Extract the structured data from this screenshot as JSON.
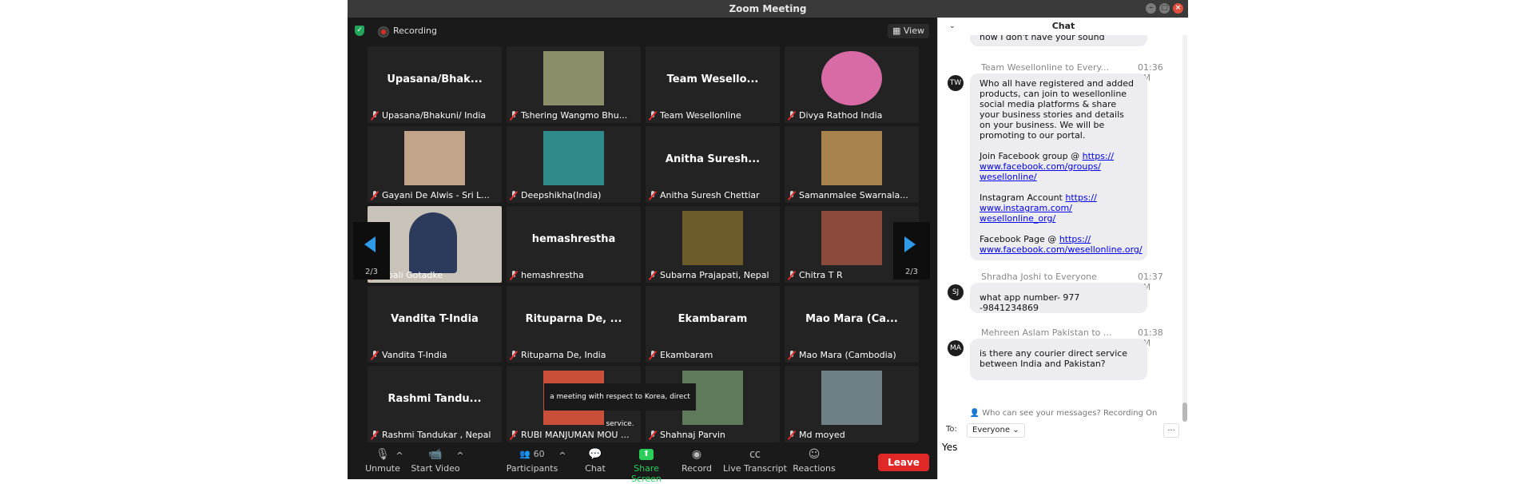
{
  "window": {
    "title": "Zoom Meeting"
  },
  "topbar": {
    "recording": "Recording",
    "view": "View"
  },
  "tiles": [
    {
      "big": "Upasana/Bhak...",
      "label": "Upasana/Bhakuni/ India",
      "photo": ""
    },
    {
      "big": "",
      "label": "Tshering Wangmo Bhu...",
      "photo": "#8a8f6a"
    },
    {
      "big": "Team Wesello...",
      "label": "Team Wesellonline",
      "photo": ""
    },
    {
      "big": "",
      "label": "Divya Rathod India",
      "photo": "#d86aa5"
    },
    {
      "big": "",
      "label": "Gayani De Alwis - Sri L...",
      "photo": "#c2a48a"
    },
    {
      "big": "",
      "label": "Deepshikha(India)",
      "photo": "#2f8b8a"
    },
    {
      "big": "Anitha Suresh...",
      "label": "Anitha Suresh Chettiar",
      "photo": ""
    },
    {
      "big": "",
      "label": "Samanmalee Swarnala...",
      "photo": "#a8824c"
    },
    {
      "big": "",
      "label": "epali Gotadke",
      "photo": "speaker"
    },
    {
      "big": "hemashrestha",
      "label": "hemashrestha",
      "photo": ""
    },
    {
      "big": "",
      "label": "Subarna Prajapati, Nepal",
      "photo": "#6e5b2a"
    },
    {
      "big": "",
      "label": "Chitra T R",
      "photo": "#8b4a3c"
    },
    {
      "big": "Vandita T-India",
      "label": "Vandita T-India",
      "photo": ""
    },
    {
      "big": "Rituparna De, ...",
      "label": "Rituparna De, India",
      "photo": ""
    },
    {
      "big": "Ekambaram",
      "label": "Ekambaram",
      "photo": ""
    },
    {
      "big": "Mao Mara (Ca...",
      "label": "Mao Mara (Cambodia)",
      "photo": ""
    },
    {
      "big": "Rashmi Tandu...",
      "label": "Rashmi Tandukar , Nepal",
      "photo": ""
    },
    {
      "big": "",
      "label": "RUBI MANJUMAN MOU ...",
      "photo": "#c94f3a"
    },
    {
      "big": "",
      "label": "Shahnaj Parvin",
      "photo": "#5e7a5a"
    },
    {
      "big": "",
      "label": "Md moyed",
      "photo": "#6f7f86"
    }
  ],
  "pager": {
    "left": "2/3",
    "right": "2/3"
  },
  "caption": "a meeting with respect to Korea, direct service.",
  "toolbar": {
    "unmute": "Unmute",
    "start_video": "Start Video",
    "participants": "Participants",
    "participant_count": "60",
    "chat": "Chat",
    "share": "Share Screen",
    "record": "Record",
    "transcript": "Live Transcript",
    "reactions": "Reactions",
    "leave": "Leave"
  },
  "chat": {
    "title": "Chat",
    "prev_text": "now I don't have your sound",
    "messages": [
      {
        "initials": "TW",
        "sender": "Team Wesellonline to Every...",
        "time": "01:36 PM",
        "body1": "Who all have registered and added products, can join to wesellonline social media platforms & share your business stories and details on your business. We will be promoting to our portal.",
        "fb_label": "Join Facebook group @ ",
        "fb_link1": "https://",
        "fb_link2": "www.facebook.com/groups/",
        "fb_link3": "wesellonline/",
        "ig_label": "Instagram Account ",
        "ig_link1": "https://",
        "ig_link2": "www.instagram.com/",
        "ig_link3": "wesellonline_org/",
        "fp_label": "Facebook Page @ ",
        "fp_link1": "https://",
        "fp_link2": "www.facebook.com/wesellonline.org/"
      },
      {
        "initials": "SJ",
        "sender": "Shradha Joshi to Everyone",
        "time": "01:37 PM",
        "body": "what app number- 977 -9841234869"
      },
      {
        "initials": "MA",
        "sender": "Mehreen Aslam Pakistan to ...",
        "time": "01:38 PM",
        "body": "is there any courier direct service between India and Pakistan?"
      }
    ],
    "who_can_see": "Who can see your messages? Recording On",
    "to_label": "To:",
    "to_value": "Everyone",
    "more": "...",
    "input_value": "Yes"
  }
}
